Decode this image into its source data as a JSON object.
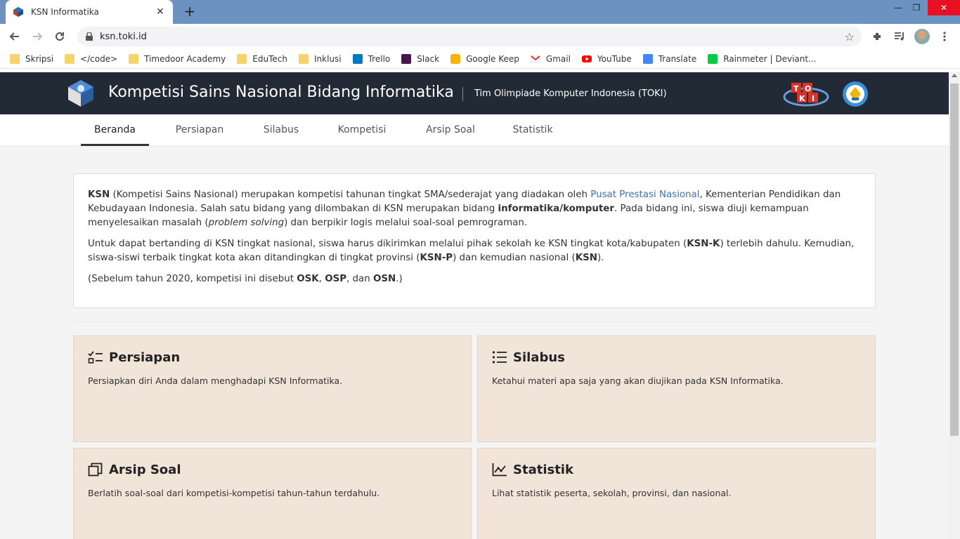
{
  "browser": {
    "tab_title": "KSN Informatika",
    "tab_close": "✕",
    "new_tab": "+",
    "url": "ksn.toki.id",
    "window_controls": {
      "minimize": "—",
      "restore": "❐",
      "close": "✕"
    }
  },
  "bookmarks": [
    {
      "label": "Skripsi",
      "icon": "folder-icon"
    },
    {
      "label": "</code>",
      "icon": "folder-icon"
    },
    {
      "label": "Timedoor Academy",
      "icon": "folder-icon"
    },
    {
      "label": "EduTech",
      "icon": "folder-icon"
    },
    {
      "label": "Inklusi",
      "icon": "folder-icon"
    },
    {
      "label": "Trello",
      "icon": "trello-icon"
    },
    {
      "label": "Slack",
      "icon": "slack-icon"
    },
    {
      "label": "Google Keep",
      "icon": "keep-icon"
    },
    {
      "label": "Gmail",
      "icon": "gmail-icon"
    },
    {
      "label": "YouTube",
      "icon": "youtube-icon"
    },
    {
      "label": "Translate",
      "icon": "translate-icon"
    },
    {
      "label": "Rainmeter | Deviant...",
      "icon": "deviantart-icon"
    }
  ],
  "site": {
    "title": "Kompetisi Sains Nasional Bidang Informatika",
    "subtitle": "Tim Olimpiade Komputer Indonesia (TOKI)"
  },
  "nav": [
    {
      "label": "Beranda",
      "active": true
    },
    {
      "label": "Persiapan",
      "active": false
    },
    {
      "label": "Silabus",
      "active": false
    },
    {
      "label": "Kompetisi",
      "active": false
    },
    {
      "label": "Arsip Soal",
      "active": false
    },
    {
      "label": "Statistik",
      "active": false
    }
  ],
  "intro": {
    "p1": {
      "ksn": "KSN",
      "t1": " (Kompetisi Sains Nasional) merupakan kompetisi tahunan tingkat SMA/sederajat yang diadakan oleh ",
      "link": "Pusat Prestasi Nasional",
      "t2": ", Kementerian Pendidikan dan Kebudayaan Indonesia. Salah satu bidang yang dilombakan di KSN merupakan bidang ",
      "bold": "informatika/komputer",
      "t3": ". Pada bidang ini, siswa diuji kemampuan menyelesaikan masalah (",
      "italic": "problem solving",
      "t4": ") dan berpikir logis melalui soal-soal pemrograman."
    },
    "p2": {
      "t1": "Untuk dapat bertanding di KSN tingkat nasional, siswa harus dikirimkan melalui pihak sekolah ke KSN tingkat kota/kabupaten (",
      "b1": "KSN-K",
      "t2": ") terlebih dahulu. Kemudian, siswa-siswi terbaik tingkat kota akan ditandingkan di tingkat provinsi (",
      "b2": "KSN-P",
      "t3": ") dan kemudian nasional (",
      "b3": "KSN",
      "t4": ")."
    },
    "p3": {
      "t1": "(Sebelum tahun 2020, kompetisi ini disebut ",
      "b1": "OSK",
      "t2": ", ",
      "b2": "OSP",
      "t3": ", dan ",
      "b3": "OSN",
      "t4": ".)"
    }
  },
  "cards": [
    {
      "title": "Persiapan",
      "desc": "Persiapkan diri Anda dalam menghadapi KSN Informatika.",
      "icon": "checklist-icon"
    },
    {
      "title": "Silabus",
      "desc": "Ketahui materi apa saja yang akan diujikan pada KSN Informatika.",
      "icon": "list-icon"
    },
    {
      "title": "Arsip Soal",
      "desc": "Berlatih soal-soal dari kompetisi-kompetisi tahun-tahun terdahulu.",
      "icon": "archive-icon"
    },
    {
      "title": "Statistik",
      "desc": "Lihat statistik peserta, sekolah, provinsi, dan nasional.",
      "icon": "chart-icon"
    }
  ],
  "colors": {
    "header_bg": "#222a35",
    "card_bg": "#f1e4d8",
    "link": "#3a72b5",
    "tabstrip": "#6b92c1"
  }
}
